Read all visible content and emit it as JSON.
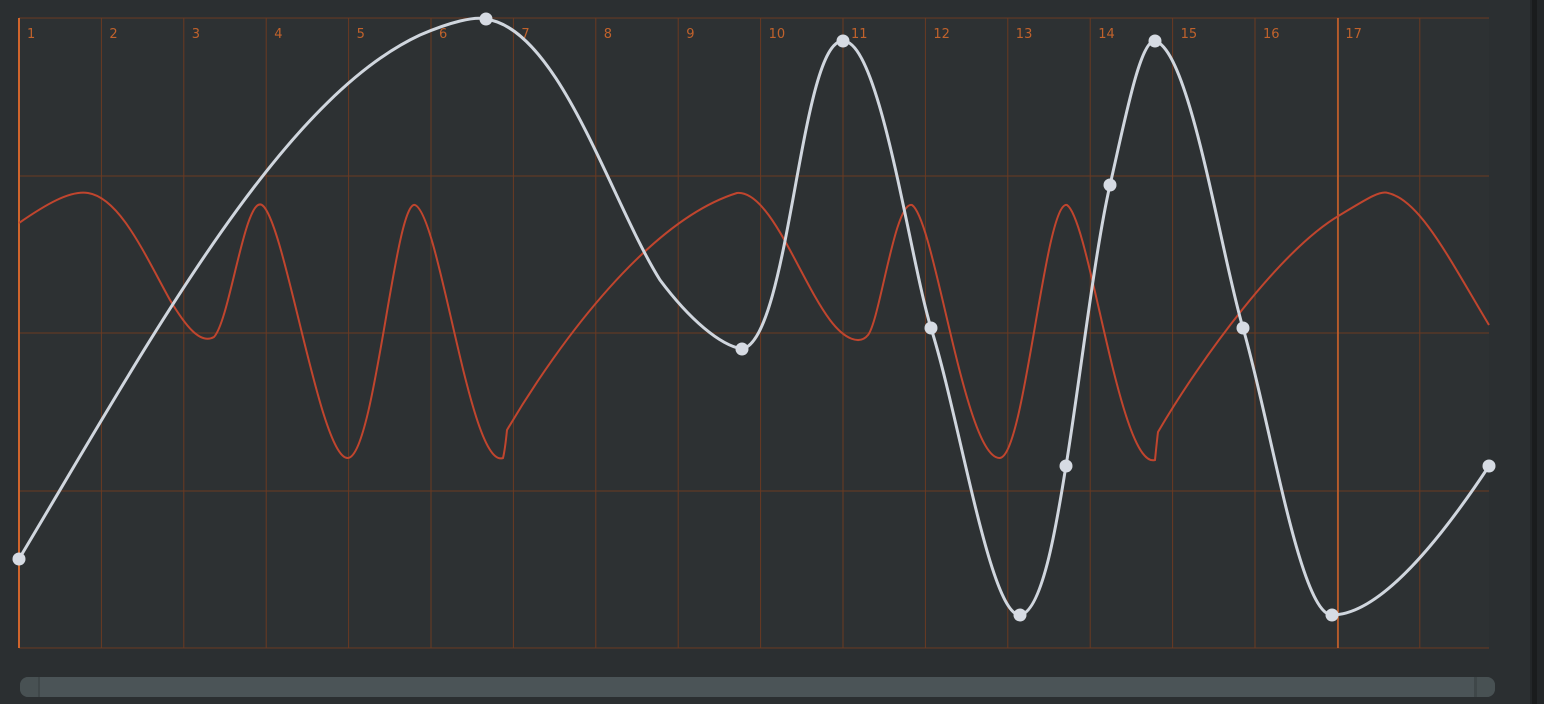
{
  "editor": {
    "bar_numbers": [
      "1",
      "2",
      "3",
      "4",
      "5",
      "6",
      "7",
      "8",
      "9",
      "10",
      "11",
      "12",
      "13",
      "14",
      "15",
      "16",
      "17"
    ],
    "playhead_bar": "17"
  },
  "colors": {
    "background": "#2b2f31",
    "grid_line": "#6a3a22",
    "bar_number": "#c0622c",
    "playhead": "#d0652c",
    "lfo_curve": "#c0452e",
    "automation_curve": "#d0d6de",
    "control_point": "#d6dbe3"
  },
  "automation": {
    "points_label": "automation-curve"
  },
  "scrollbar": {
    "thumb_position": 0.0
  }
}
